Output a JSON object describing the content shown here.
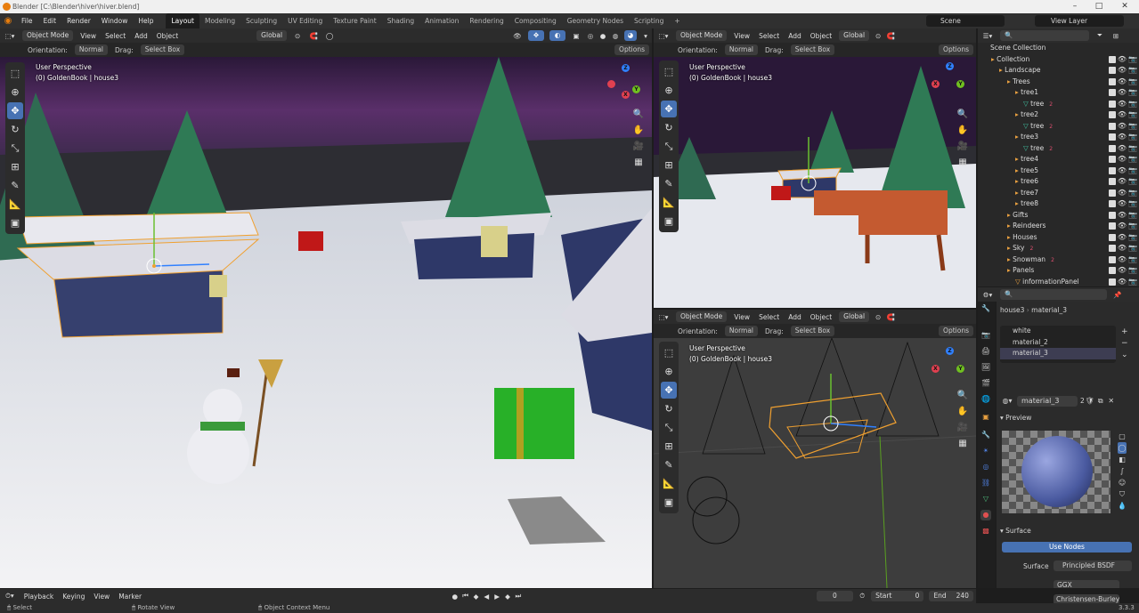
{
  "window": {
    "title": "Blender [C:\\Blender\\hiver\\hiver.blend]",
    "minimize": "–",
    "maximize": "□",
    "close": "✕"
  },
  "menus": [
    "File",
    "Edit",
    "Render",
    "Window",
    "Help"
  ],
  "workspaces": [
    "Layout",
    "Modeling",
    "Sculpting",
    "UV Editing",
    "Texture Paint",
    "Shading",
    "Animation",
    "Rendering",
    "Compositing",
    "Geometry Nodes",
    "Scripting"
  ],
  "workspace_add": "+",
  "scene": {
    "name": "Scene",
    "view_layer": "View Layer"
  },
  "viewport_main": {
    "mode": "Object Mode",
    "menus": [
      "View",
      "Select",
      "Add",
      "Object"
    ],
    "transform": "Global",
    "orientation_label": "Orientation:",
    "orientation": "Normal",
    "drag_label": "Drag:",
    "drag": "Select Box",
    "options": "Options",
    "info_line1": "User Perspective",
    "info_line2": "(0) GoldenBook | house3"
  },
  "viewport_tr": {
    "mode": "Object Mode",
    "menus": [
      "View",
      "Select",
      "Add",
      "Object"
    ],
    "transform": "Global",
    "orientation_label": "Orientation:",
    "orientation": "Normal",
    "drag_label": "Drag:",
    "drag": "Select Box",
    "options": "Options",
    "info_line1": "User Perspective",
    "info_line2": "(0) GoldenBook | house3"
  },
  "viewport_br": {
    "mode": "Object Mode",
    "menus": [
      "View",
      "Select",
      "Add",
      "Object"
    ],
    "transform": "Global",
    "orientation_label": "Orientation:",
    "orientation": "Normal",
    "drag_label": "Drag:",
    "drag": "Select Box",
    "options": "Options",
    "info_line1": "User Perspective",
    "info_line2": "(0) GoldenBook | house3"
  },
  "gizmo_labels": {
    "x": "X",
    "y": "Y",
    "z": "Z"
  },
  "outliner": {
    "root": "Scene Collection",
    "rows": [
      {
        "label": "Collection",
        "indent": 1
      },
      {
        "label": "Landscape",
        "indent": 2
      },
      {
        "label": "Trees",
        "indent": 3
      },
      {
        "label": "tree1",
        "indent": 4
      },
      {
        "label": "tree",
        "indent": 5,
        "badge": "2"
      },
      {
        "label": "tree2",
        "indent": 4
      },
      {
        "label": "tree",
        "indent": 5,
        "badge": "2"
      },
      {
        "label": "tree3",
        "indent": 4
      },
      {
        "label": "tree",
        "indent": 5,
        "badge": "2"
      },
      {
        "label": "tree4",
        "indent": 4
      },
      {
        "label": "tree5",
        "indent": 4
      },
      {
        "label": "tree6",
        "indent": 4
      },
      {
        "label": "tree7",
        "indent": 4
      },
      {
        "label": "tree8",
        "indent": 4
      },
      {
        "label": "Gifts",
        "indent": 3
      },
      {
        "label": "Reindeers",
        "indent": 3
      },
      {
        "label": "Houses",
        "indent": 3
      },
      {
        "label": "Sky",
        "indent": 3,
        "badge": "2"
      },
      {
        "label": "Snowman",
        "indent": 3,
        "badge": "2"
      },
      {
        "label": "Panels",
        "indent": 3
      },
      {
        "label": "informationPanel",
        "indent": 4
      }
    ]
  },
  "properties": {
    "breadcrumb_object": "house3",
    "breadcrumb_material": "material_3",
    "slots": [
      "white",
      "material_2",
      "material_3"
    ],
    "material_name": "material_3",
    "users": "2",
    "preview_label": "Preview",
    "surface_label": "Surface",
    "use_nodes": "Use Nodes",
    "surface_field": "Surface",
    "surface_value": "Principled BSDF",
    "distribution": "GGX",
    "subsurface": "Christensen-Burley"
  },
  "timeline": {
    "menus": [
      "Playback",
      "Keying",
      "View",
      "Marker"
    ],
    "current_frame": "0",
    "start_label": "Start",
    "start": "0",
    "end_label": "End",
    "end": "240"
  },
  "statusbar": {
    "select": "Select",
    "rotate": "Rotate View",
    "context": "Object Context Menu",
    "version": "3.3.3"
  },
  "colors": {
    "accent": "#4772b3",
    "selected_orange": "#f0a030",
    "bg": "#1d1d1d"
  }
}
